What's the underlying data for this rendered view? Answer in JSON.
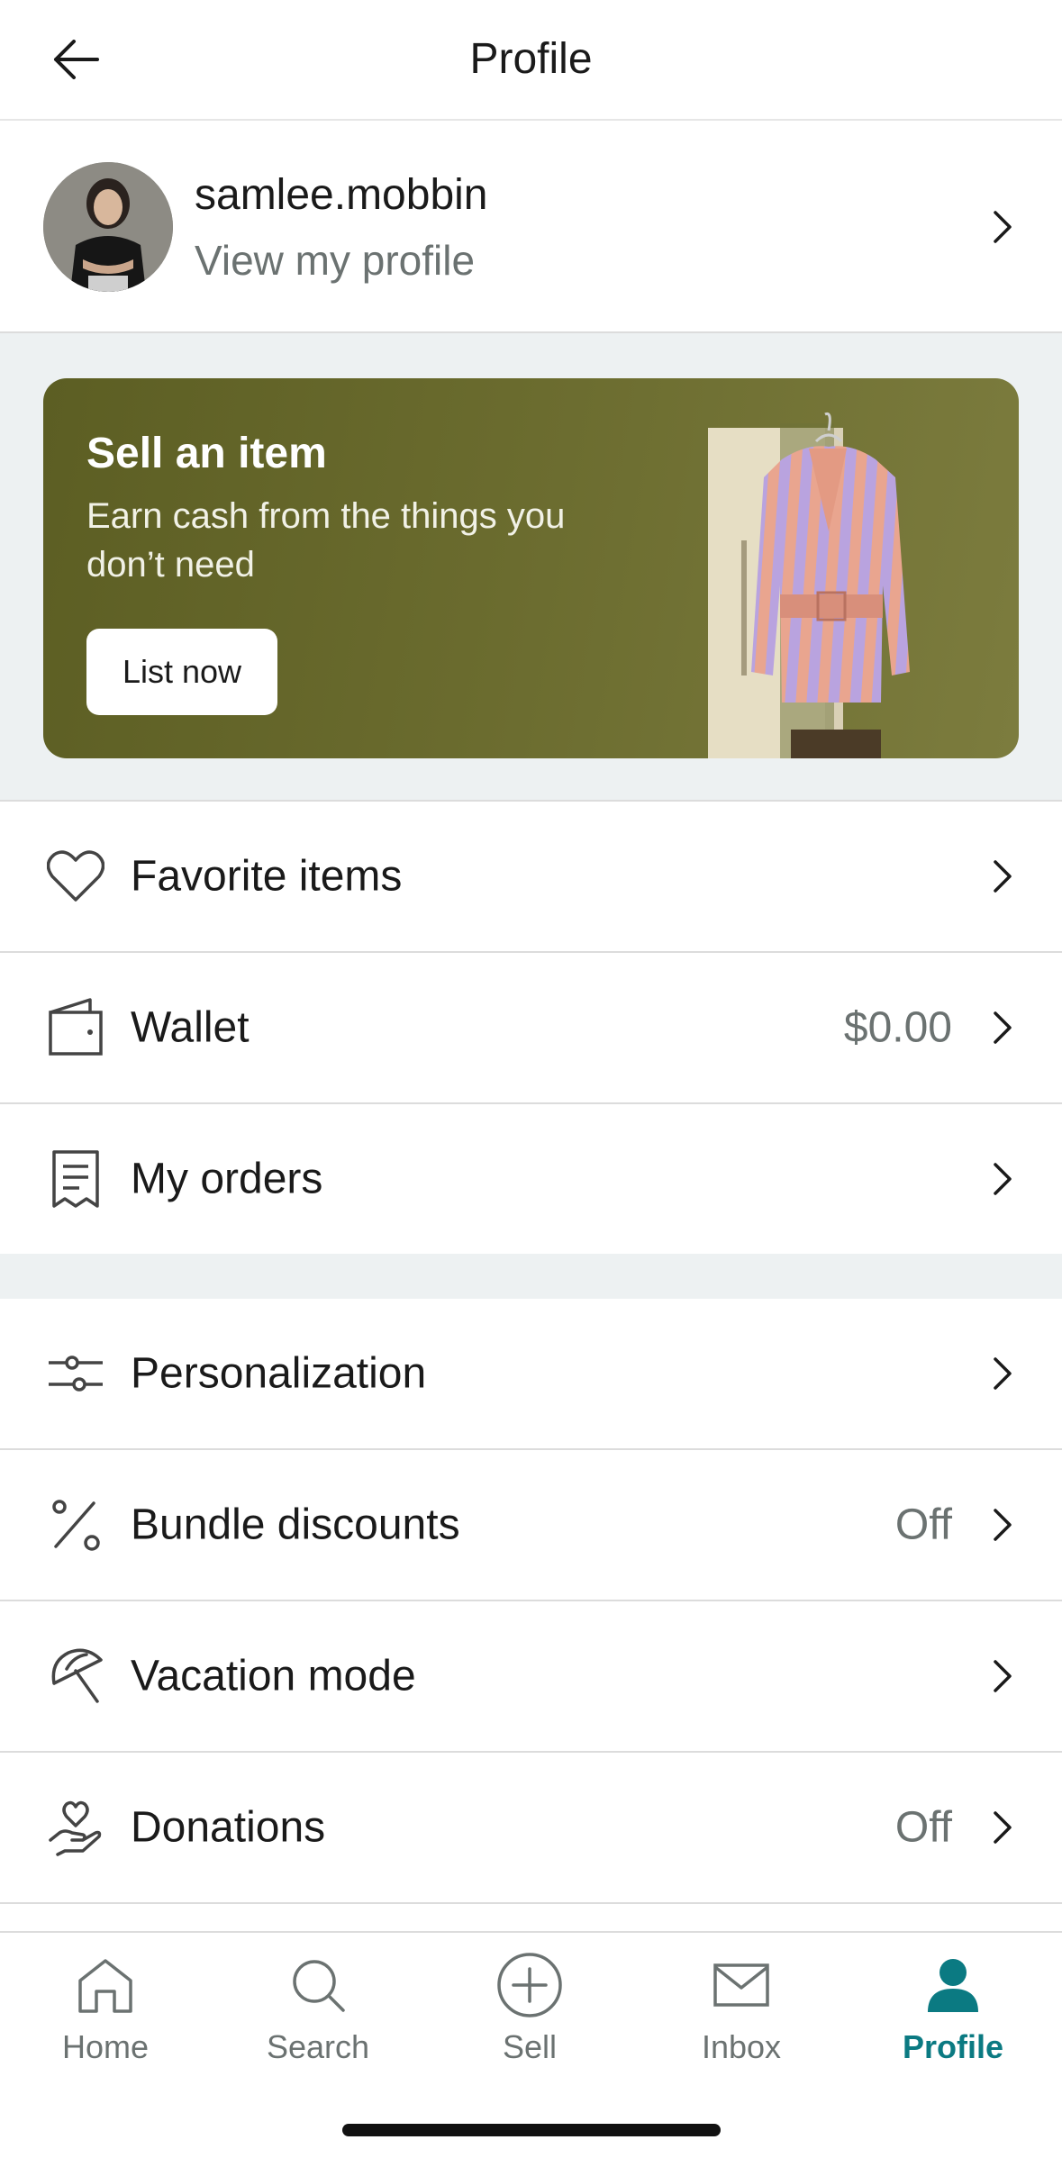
{
  "header": {
    "title": "Profile"
  },
  "profile": {
    "username": "samlee.mobbin",
    "link_text": "View my profile"
  },
  "promo": {
    "title": "Sell an item",
    "subtitle": "Earn cash from the things you don’t need",
    "button_label": "List now"
  },
  "menu_group_1": [
    {
      "label": "Favorite items",
      "icon": "heart-icon",
      "value": ""
    },
    {
      "label": "Wallet",
      "icon": "wallet-icon",
      "value": "$0.00"
    },
    {
      "label": "My orders",
      "icon": "receipt-icon",
      "value": ""
    }
  ],
  "menu_group_2": [
    {
      "label": "Personalization",
      "icon": "sliders-icon",
      "value": ""
    },
    {
      "label": "Bundle discounts",
      "icon": "percent-icon",
      "value": "Off"
    },
    {
      "label": "Vacation mode",
      "icon": "beach-umbrella-icon",
      "value": ""
    },
    {
      "label": "Donations",
      "icon": "heart-hand-icon",
      "value": "Off"
    }
  ],
  "bottom_nav": [
    {
      "label": "Home",
      "icon": "home-icon",
      "active": false
    },
    {
      "label": "Search",
      "icon": "search-icon",
      "active": false
    },
    {
      "label": "Sell",
      "icon": "plus-circle-icon",
      "active": false
    },
    {
      "label": "Inbox",
      "icon": "mail-icon",
      "active": false
    },
    {
      "label": "Profile",
      "icon": "profile-icon",
      "active": true
    }
  ],
  "colors": {
    "accent": "#0b7a82",
    "promo_bg": "#6a6b2e",
    "section_bg": "#edf1f2",
    "muted_text": "#6b7271"
  }
}
